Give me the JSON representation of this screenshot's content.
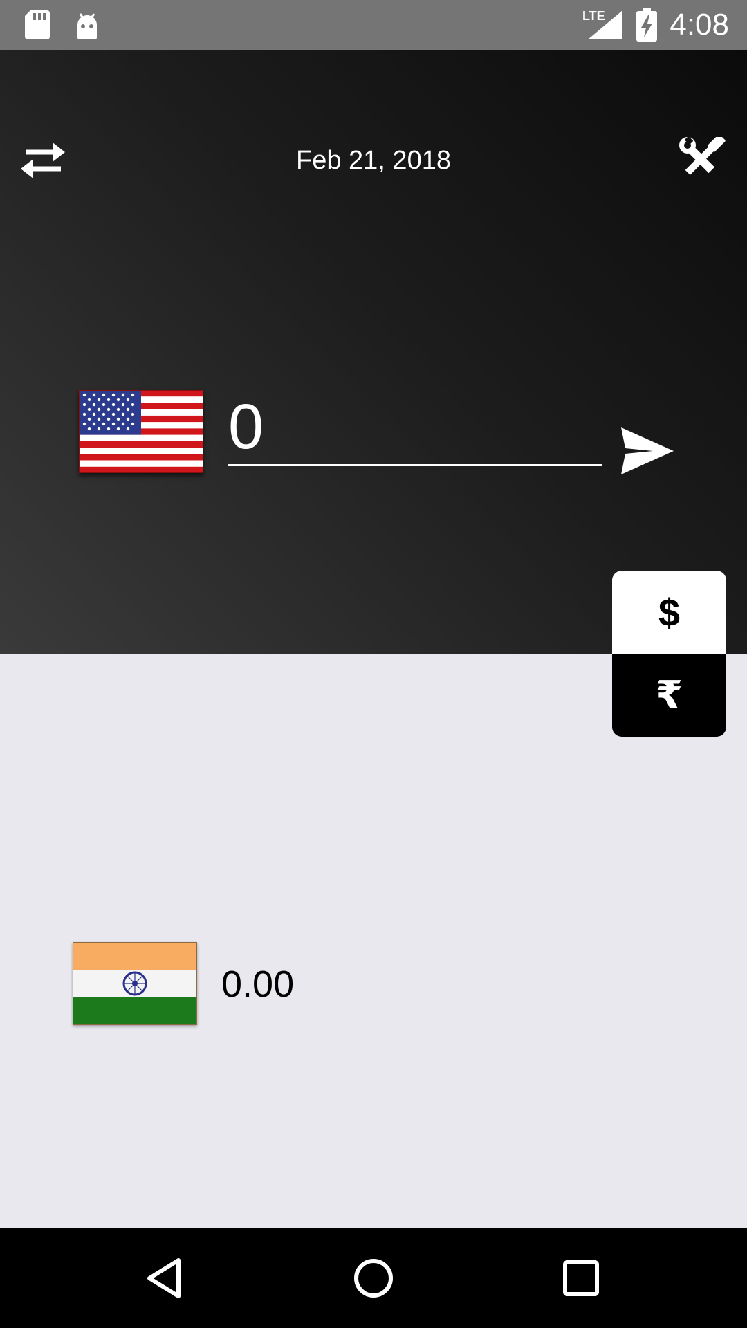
{
  "status_bar": {
    "time": "4:08",
    "network": "LTE",
    "icons": [
      "sd-card-icon",
      "android-icon",
      "lte-signal-icon",
      "battery-charging-icon"
    ]
  },
  "header": {
    "date": "Feb 21, 2018",
    "swap_icon": "swap-arrows-icon",
    "settings_icon": "tools-icon"
  },
  "source": {
    "flag": "us-flag",
    "amount_value": "0",
    "send_icon": "send-icon"
  },
  "currency_toggle": {
    "dollar_symbol": "$",
    "rupee_symbol": "₹",
    "selected": "$"
  },
  "target": {
    "flag": "india-flag",
    "result": "0.00"
  },
  "nav_bar": {
    "icons": [
      "back-icon",
      "home-icon",
      "recents-icon"
    ]
  },
  "colors": {
    "status_bar": "#757575",
    "top_panel_dark": "#0b0b0b",
    "top_panel_light": "#3a3a3a",
    "bottom_panel": "#e8e8ee",
    "nav_bar": "#000000"
  }
}
